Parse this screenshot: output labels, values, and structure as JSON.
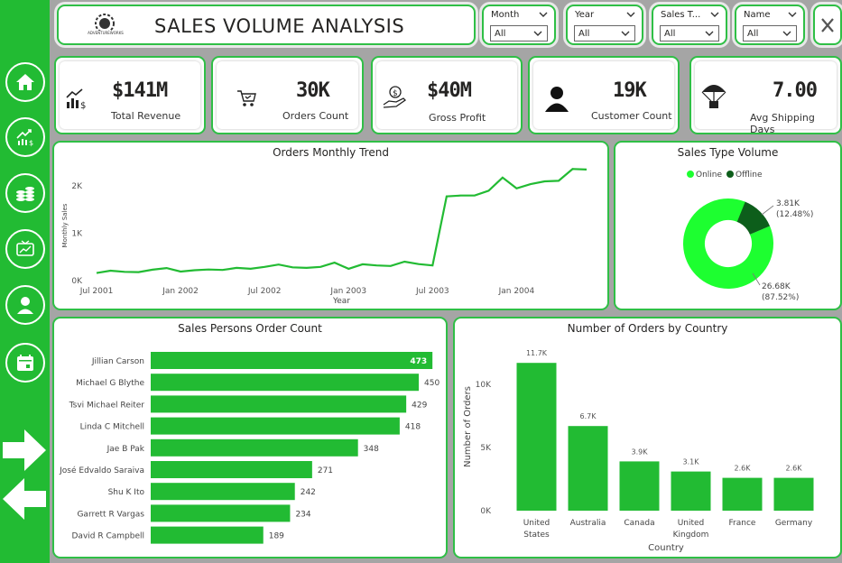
{
  "header": {
    "title": "SALES VOLUME ANALYSIS",
    "logo_text": "ADVENTUREWORKS"
  },
  "slicers": [
    {
      "label": "Month",
      "value": "All"
    },
    {
      "label": "Year",
      "value": "All"
    },
    {
      "label": "Sales T...",
      "value": "All"
    },
    {
      "label": "Name",
      "value": "All"
    }
  ],
  "kpis": [
    {
      "value": "$141M",
      "label": "Total Revenue",
      "icon": "revenue-chart-icon"
    },
    {
      "value": "30K",
      "label": "Orders Count",
      "icon": "shopping-cart-icon"
    },
    {
      "value": "$40M",
      "label": "Gross Profit",
      "icon": "money-hand-icon"
    },
    {
      "value": "19K",
      "label": "Customer Count",
      "icon": "person-icon"
    },
    {
      "value": "7.00",
      "label": "Avg Shipping Days",
      "icon": "parachute-icon"
    }
  ],
  "nav": [
    "home-icon",
    "growth-chart-icon",
    "coins-icon",
    "tv-chart-icon",
    "user-icon",
    "calendar-icon"
  ],
  "colors": {
    "accent": "#22bb33",
    "donut_online": "#1dff30",
    "donut_offline": "#0d5e1b"
  },
  "chart_data": [
    {
      "type": "line",
      "title": "Orders Monthly Trend",
      "xlabel": "Year",
      "ylabel": "Monthly Sales",
      "ylim": [
        0,
        2500
      ],
      "yticks": [
        {
          "v": 0,
          "label": "0K"
        },
        {
          "v": 1000,
          "label": "1K"
        },
        {
          "v": 2000,
          "label": "2K"
        }
      ],
      "xticks": [
        "Jul 2001",
        "Jan 2002",
        "Jul 2002",
        "Jan 2003",
        "Jul 2003",
        "Jan 2004"
      ],
      "x_months_start": "2001-07",
      "values": [
        160,
        210,
        185,
        180,
        230,
        265,
        190,
        220,
        235,
        225,
        270,
        250,
        290,
        340,
        280,
        270,
        290,
        380,
        250,
        345,
        320,
        310,
        400,
        350,
        320,
        1780,
        1800,
        1800,
        1900,
        2180,
        1950,
        2040,
        2100,
        2110,
        2360,
        2350
      ],
      "grid": false
    },
    {
      "type": "pie",
      "title": "Sales Type Volume",
      "legend": [
        "Online",
        "Offline"
      ],
      "legend_position": "top",
      "slices": [
        {
          "name": "Online",
          "value": 26.68,
          "value_label": "26.68K",
          "pct_label": "(87.52%)"
        },
        {
          "name": "Offline",
          "value": 3.81,
          "value_label": "3.81K",
          "pct_label": "(12.48%)"
        }
      ]
    },
    {
      "type": "bar",
      "orientation": "horizontal",
      "title": "Sales Persons Order Count",
      "categories": [
        "Jillian Carson",
        "Michael G Blythe",
        "Tsvi Michael Reiter",
        "Linda C Mitchell",
        "Jae B Pak",
        "José Edvaldo Saraiva",
        "Shu K Ito",
        "Garrett R Vargas",
        "David R Campbell"
      ],
      "values": [
        473,
        450,
        429,
        418,
        348,
        271,
        242,
        234,
        189
      ],
      "xlim": [
        0,
        500
      ]
    },
    {
      "type": "bar",
      "title": "Number of Orders by Country",
      "xlabel": "Country",
      "ylabel": "Number of Orders",
      "categories": [
        [
          "United",
          "States"
        ],
        [
          "Australia"
        ],
        [
          "Canada"
        ],
        [
          "United",
          "Kingdom"
        ],
        [
          "France"
        ],
        [
          "Germany"
        ]
      ],
      "values": [
        11700,
        6700,
        3900,
        3100,
        2600,
        2600
      ],
      "value_labels": [
        "11.7K",
        "6.7K",
        "3.9K",
        "3.1K",
        "2.6K",
        "2.6K"
      ],
      "ylim": [
        0,
        12500
      ],
      "yticks": [
        {
          "v": 0,
          "label": "0K"
        },
        {
          "v": 5000,
          "label": "5K"
        },
        {
          "v": 10000,
          "label": "10K"
        }
      ]
    }
  ]
}
